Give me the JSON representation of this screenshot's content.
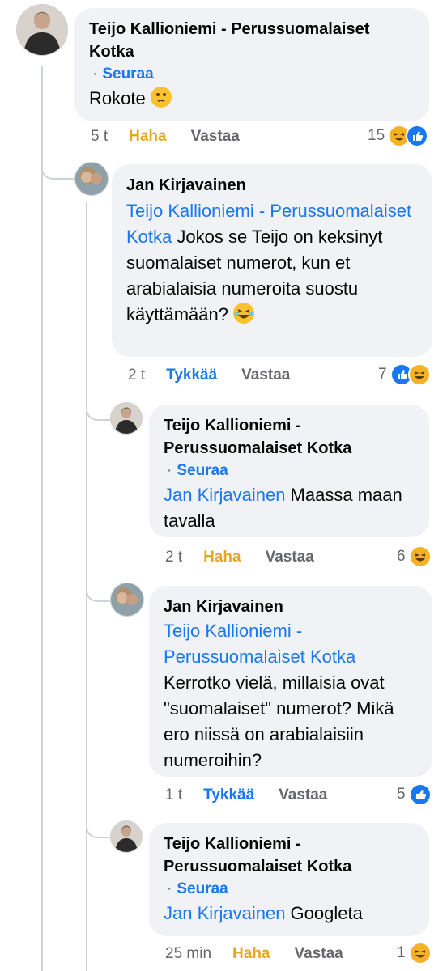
{
  "comments": [
    {
      "author": "Teijo Kallioniemi - Perussuomalaiset Kotka",
      "follow_label": "Seuraa",
      "text": "Rokote",
      "emoji": "thinking-face",
      "time": "5 t",
      "reaction_action": "Haha",
      "reply_label": "Vastaa",
      "reaction_count": "15"
    },
    {
      "author": "Jan Kirjavainen",
      "mention": "Teijo Kallioniemi - Perussuomalaiset Kotka",
      "text": " Jokos se Teijo on keksinyt suomalaiset numerot, kun et arabialaisia numeroita suostu käyttämään?",
      "emoji": "laughing-face",
      "time": "2 t",
      "reaction_action": "Tykkää",
      "reply_label": "Vastaa",
      "reaction_count": "7"
    },
    {
      "author": "Teijo Kallioniemi - Perussuomalaiset Kotka",
      "follow_label": "Seuraa",
      "mention": "Jan Kirjavainen",
      "text": " Maassa maan tavalla",
      "time": "2 t",
      "reaction_action": "Haha",
      "reply_label": "Vastaa",
      "reaction_count": "6"
    },
    {
      "author": "Jan Kirjavainen",
      "mention": "Teijo Kallioniemi - Perussuomalaiset Kotka",
      "text": "Kerrotko vielä, millaisia ovat \"suomalaiset\" numerot? Mikä ero niissä on arabialaisiin numeroihin?",
      "time": "1 t",
      "reaction_action": "Tykkää",
      "reply_label": "Vastaa",
      "reaction_count": "5"
    },
    {
      "author": "Teijo Kallioniemi - Perussuomalaiset Kotka",
      "follow_label": "Seuraa",
      "mention": "Jan Kirjavainen",
      "text": " Googleta",
      "time": "25 min",
      "reaction_action": "Haha",
      "reply_label": "Vastaa",
      "reaction_count": "1"
    }
  ],
  "colors": {
    "link": "#1877f2",
    "haha": "#e5a823",
    "bubble": "#f0f2f5",
    "meta": "#65676b"
  }
}
